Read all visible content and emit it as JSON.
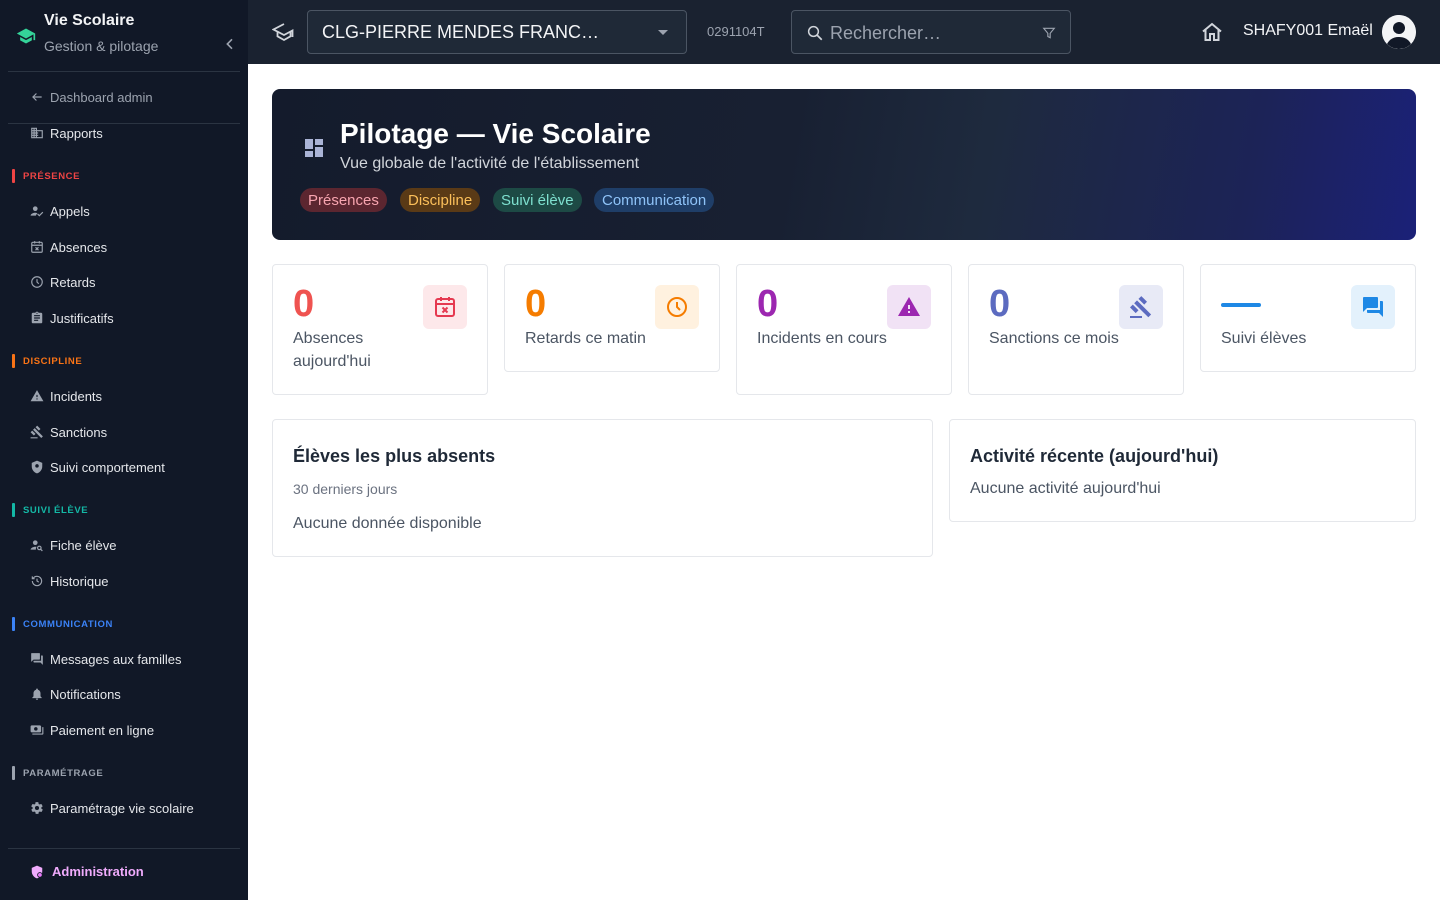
{
  "sidebar": {
    "brand_title": "Vie Scolaire",
    "brand_subtitle": "Gestion & pilotage",
    "back_link": "Dashboard admin",
    "rapports": "Rapports",
    "sections": {
      "presence": {
        "label": "PRÉSENCE",
        "color": "#ef4444"
      },
      "discipline": {
        "label": "DISCIPLINE",
        "color": "#f97316"
      },
      "suivi": {
        "label": "SUIVI ÉLÈVE",
        "color": "#14b8a6"
      },
      "communication": {
        "label": "COMMUNICATION",
        "color": "#3b82f6"
      },
      "parametrage": {
        "label": "PARAMÉTRAGE",
        "color": "#9ca3af"
      }
    },
    "items": {
      "appels": "Appels",
      "absences": "Absences",
      "retards": "Retards",
      "justificatifs": "Justificatifs",
      "incidents": "Incidents",
      "sanctions": "Sanctions",
      "suivi_comportement": "Suivi comportement",
      "fiche_eleve": "Fiche élève",
      "historique": "Historique",
      "messages": "Messages aux familles",
      "notifications": "Notifications",
      "paiement": "Paiement en ligne",
      "parametrage": "Paramétrage vie scolaire"
    },
    "admin": "Administration"
  },
  "topbar": {
    "school": "CLG-PIERRE MENDES FRANC…",
    "uai": "0291104T",
    "search_placeholder": "Rechercher…",
    "user": "SHAFY001 Emaël"
  },
  "hero": {
    "title": "Pilotage — Vie Scolaire",
    "subtitle": "Vue globale de l'activité de l'établissement",
    "chips": [
      "Présences",
      "Discipline",
      "Suivi élève",
      "Communication"
    ]
  },
  "stats": [
    {
      "value": "0",
      "label": "Absences aujourd'hui",
      "color": "#ef4444",
      "icon": "calendar-x-icon"
    },
    {
      "value": "0",
      "label": "Retards ce matin",
      "color": "#f57c00",
      "icon": "clock-icon"
    },
    {
      "value": "0",
      "label": "Incidents en cours",
      "color": "#9c27b0",
      "icon": "warning-icon"
    },
    {
      "value": "0",
      "label": "Sanctions ce mois",
      "color": "#5c6bc0",
      "icon": "gavel-icon"
    },
    {
      "value": "—",
      "label": "Suivi élèves",
      "color": "#1e88e5",
      "icon": "forum-icon"
    }
  ],
  "panels": {
    "absents": {
      "title": "Élèves les plus absents",
      "subtitle": "30 derniers jours",
      "empty": "Aucune donnée disponible"
    },
    "activity": {
      "title": "Activité récente (aujourd'hui)",
      "empty": "Aucune activité aujourd'hui"
    }
  }
}
